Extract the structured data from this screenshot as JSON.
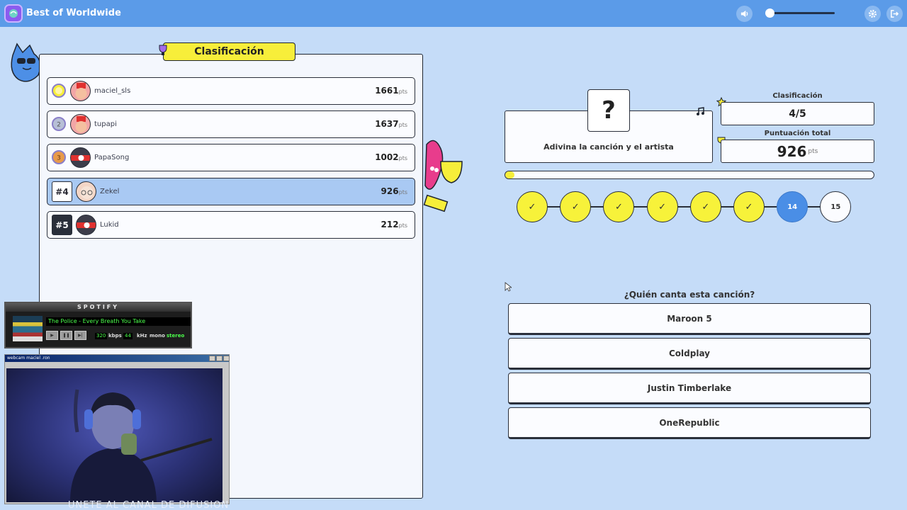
{
  "app": {
    "title": "Best of Worldwide"
  },
  "topbar": {
    "volume_icon": "speaker-icon",
    "volume_level": 0.0,
    "settings_icon": "gear-icon",
    "exit_icon": "exit-icon"
  },
  "leaderboard": {
    "title": "Clasificación",
    "points_unit": "pts",
    "players": [
      {
        "rank": "1",
        "name": "maciel_sls",
        "points": "1661",
        "medal": "gold-medal-icon"
      },
      {
        "rank": "2",
        "name": "tupapi",
        "points": "1637",
        "medal": "silver-medal-icon"
      },
      {
        "rank": "3",
        "name": "PapaSong",
        "points": "1002",
        "medal": "bronze-medal-icon"
      },
      {
        "rank": "#4",
        "name": "Zekel",
        "points": "926",
        "me": true
      },
      {
        "rank": "#5",
        "name": "Lukid",
        "points": "212"
      }
    ]
  },
  "question": {
    "mark": "?",
    "text": "Adivina la canción y el artista",
    "prompt": "¿Quién canta esta canción?"
  },
  "stats": {
    "rank_label": "Clasificación",
    "rank_value": "4/5",
    "score_label": "Puntuación total",
    "score_value": "926",
    "score_unit": "pts"
  },
  "progress": {
    "fraction": 0.015
  },
  "rounds": [
    {
      "state": "done",
      "label": "✓"
    },
    {
      "state": "done",
      "label": "✓"
    },
    {
      "state": "done",
      "label": "✓"
    },
    {
      "state": "done",
      "label": "✓"
    },
    {
      "state": "done",
      "label": "✓"
    },
    {
      "state": "done",
      "label": "✓"
    },
    {
      "state": "current",
      "label": "14"
    },
    {
      "state": "todo",
      "label": "15"
    }
  ],
  "answers": [
    "Maroon 5",
    "Coldplay",
    "Justin Timberlake",
    "OneRepublic"
  ],
  "spotify_overlay": {
    "title": "SPOTIFY",
    "track": "The Police - Every Breath You Take",
    "bitrate": "320",
    "bitrate_unit": "kbps",
    "khz": "44",
    "khz_unit": "kHz",
    "mono": "mono",
    "stereo": "stereo"
  },
  "webcam_overlay": {
    "title": "webcam maciel .ron"
  },
  "ticker": {
    "text": "ÚNETE AL CANAL DE DIFUSIÓN PAP"
  },
  "colors": {
    "background": "#c5dcf8",
    "topbar": "#5b9be8",
    "accent_yellow": "#f7ee3a",
    "current_round": "#4a8ee6",
    "highlight_row": "#a9c9f3"
  }
}
